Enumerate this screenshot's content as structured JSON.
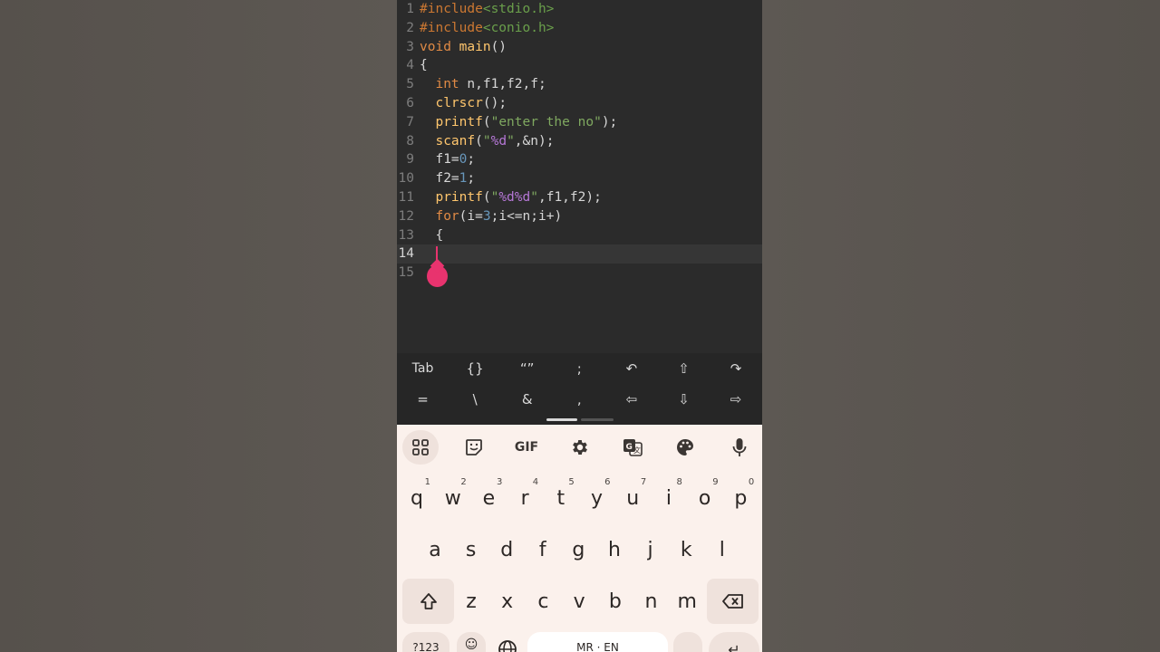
{
  "editor": {
    "lines": [
      {
        "n": "1",
        "tokens": [
          {
            "t": "#include",
            "c": "pre"
          },
          {
            "t": "<stdio.h>",
            "c": "inc"
          }
        ]
      },
      {
        "n": "2",
        "tokens": [
          {
            "t": "#include",
            "c": "pre"
          },
          {
            "t": "<conio.h>",
            "c": "inc"
          }
        ]
      },
      {
        "n": "3",
        "tokens": [
          {
            "t": "void ",
            "c": "kw"
          },
          {
            "t": "main",
            "c": "fn"
          },
          {
            "t": "()",
            "c": "pl"
          }
        ]
      },
      {
        "n": "4",
        "tokens": [
          {
            "t": "{",
            "c": "pl"
          }
        ]
      },
      {
        "n": "5",
        "tokens": [
          {
            "t": "  ",
            "c": "pl"
          },
          {
            "t": "int",
            "c": "kw"
          },
          {
            "t": " n,f1,f2,f;",
            "c": "pl"
          }
        ]
      },
      {
        "n": "6",
        "tokens": [
          {
            "t": "  ",
            "c": "pl"
          },
          {
            "t": "clrscr",
            "c": "fn"
          },
          {
            "t": "();",
            "c": "pl"
          }
        ]
      },
      {
        "n": "7",
        "tokens": [
          {
            "t": "  ",
            "c": "pl"
          },
          {
            "t": "printf",
            "c": "fn"
          },
          {
            "t": "(",
            "c": "pl"
          },
          {
            "t": "\"enter the no\"",
            "c": "str"
          },
          {
            "t": ");",
            "c": "pl"
          }
        ]
      },
      {
        "n": "8",
        "tokens": [
          {
            "t": "  ",
            "c": "pl"
          },
          {
            "t": "scanf",
            "c": "fn"
          },
          {
            "t": "(",
            "c": "pl"
          },
          {
            "t": "\"",
            "c": "str"
          },
          {
            "t": "%d",
            "c": "fmt"
          },
          {
            "t": "\"",
            "c": "str"
          },
          {
            "t": ",&n);",
            "c": "pl"
          }
        ]
      },
      {
        "n": "9",
        "tokens": [
          {
            "t": "  f1=",
            "c": "pl"
          },
          {
            "t": "0",
            "c": "num"
          },
          {
            "t": ";",
            "c": "pl"
          }
        ]
      },
      {
        "n": "10",
        "tokens": [
          {
            "t": "  f2=",
            "c": "pl"
          },
          {
            "t": "1",
            "c": "num"
          },
          {
            "t": ";",
            "c": "pl"
          }
        ]
      },
      {
        "n": "11",
        "tokens": [
          {
            "t": "  ",
            "c": "pl"
          },
          {
            "t": "printf",
            "c": "fn"
          },
          {
            "t": "(",
            "c": "pl"
          },
          {
            "t": "\"",
            "c": "str"
          },
          {
            "t": "%d%d",
            "c": "fmt"
          },
          {
            "t": "\"",
            "c": "str"
          },
          {
            "t": ",f1,f2);",
            "c": "pl"
          }
        ]
      },
      {
        "n": "12",
        "tokens": [
          {
            "t": "  ",
            "c": "pl"
          },
          {
            "t": "for",
            "c": "kw"
          },
          {
            "t": "(i=",
            "c": "pl"
          },
          {
            "t": "3",
            "c": "num"
          },
          {
            "t": ";i<=n;i+)",
            "c": "pl"
          }
        ]
      },
      {
        "n": "13",
        "tokens": [
          {
            "t": "  {",
            "c": "pl"
          }
        ]
      },
      {
        "n": "14",
        "tokens": []
      },
      {
        "n": "15",
        "tokens": []
      }
    ],
    "current_line": "14"
  },
  "symbols": {
    "row1": [
      "Tab",
      "{}",
      "“”",
      ";",
      "↶",
      "⇧",
      "↷"
    ],
    "row2": [
      "=",
      "\\",
      "&",
      ",",
      "⇦",
      "⇩",
      "⇨"
    ]
  },
  "keyboard": {
    "toolbar": [
      "apps-icon",
      "sticker-icon",
      "GIF",
      "gear-icon",
      "translate-icon",
      "palette-icon",
      "mic-icon"
    ],
    "gif_label": "GIF",
    "row1": [
      {
        "k": "q",
        "h": "1"
      },
      {
        "k": "w",
        "h": "2"
      },
      {
        "k": "e",
        "h": "3"
      },
      {
        "k": "r",
        "h": "4"
      },
      {
        "k": "t",
        "h": "5"
      },
      {
        "k": "y",
        "h": "6"
      },
      {
        "k": "u",
        "h": "7"
      },
      {
        "k": "i",
        "h": "8"
      },
      {
        "k": "o",
        "h": "9"
      },
      {
        "k": "p",
        "h": "0"
      }
    ],
    "row2": [
      "a",
      "s",
      "d",
      "f",
      "g",
      "h",
      "j",
      "k",
      "l"
    ],
    "row3": [
      "z",
      "x",
      "c",
      "v",
      "b",
      "n",
      "m"
    ],
    "bottom": {
      "numbers_label": "?123",
      "space_label": "MR · EN"
    }
  },
  "colors": {
    "cursor": "#e8336e",
    "editor_bg": "#2b2b2b",
    "keyboard_bg": "#fbf1ec"
  }
}
